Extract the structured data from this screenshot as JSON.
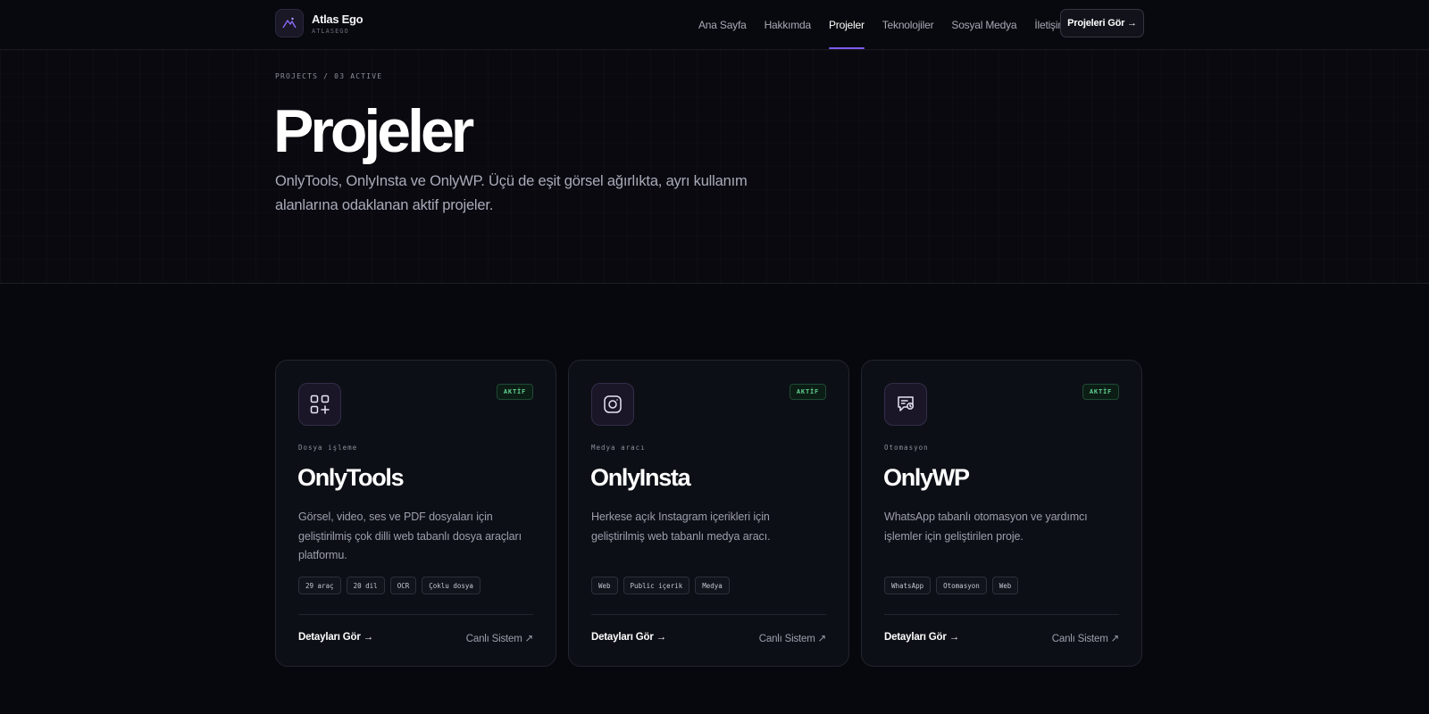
{
  "brand": {
    "name": "Atlas Ego",
    "sub": "ATLASEGO",
    "logo_icon": "mountain-logo-icon"
  },
  "nav": {
    "items": [
      {
        "label": "Ana Sayfa"
      },
      {
        "label": "Hakkımda"
      },
      {
        "label": "Projeler",
        "active": true
      },
      {
        "label": "Teknolojiler"
      },
      {
        "label": "Sosyal Medya"
      },
      {
        "label": "İletişim"
      }
    ],
    "cta_label": "Projeleri Gör →"
  },
  "hero": {
    "breadcrumb": "PROJECTS / 03 ACTIVE",
    "title": "Projeler",
    "description": "OnlyTools, OnlyInsta ve OnlyWP. Üçü de eşit görsel ağırlıkta, ayrı kullanım alanlarına odaklanan aktif projeler."
  },
  "colors": {
    "accent": "#7c5cf0",
    "active_badge": "#5fd18e",
    "background": "#07080d"
  },
  "projects": [
    {
      "icon": "apps-grid-icon",
      "badge": "AKTİF",
      "category": "Dosya işleme",
      "title": "OnlyTools",
      "description": "Görsel, video, ses ve PDF dosyaları için geliştirilmiş çok dilli web tabanlı dosya araçları platformu.",
      "tags": [
        "29 araç",
        "20 dil",
        "OCR",
        "Çoklu dosya"
      ],
      "detail_label": "Detayları Gör →",
      "live_label": "Canlı Sistem ↗"
    },
    {
      "icon": "instagram-icon",
      "badge": "AKTİF",
      "category": "Medya aracı",
      "title": "OnlyInsta",
      "description": "Herkese açık Instagram içerikleri için geliştirilmiş web tabanlı medya aracı.",
      "tags": [
        "Web",
        "Public içerik",
        "Medya"
      ],
      "detail_label": "Detayları Gör →",
      "live_label": "Canlı Sistem ↗"
    },
    {
      "icon": "chat-automation-icon",
      "badge": "AKTİF",
      "category": "Otomasyon",
      "title": "OnlyWP",
      "description": "WhatsApp tabanlı otomasyon ve yardımcı işlemler için geliştirilen proje.",
      "tags": [
        "WhatsApp",
        "Otomasyon",
        "Web"
      ],
      "detail_label": "Detayları Gör →",
      "live_label": "Canlı Sistem ↗"
    }
  ]
}
